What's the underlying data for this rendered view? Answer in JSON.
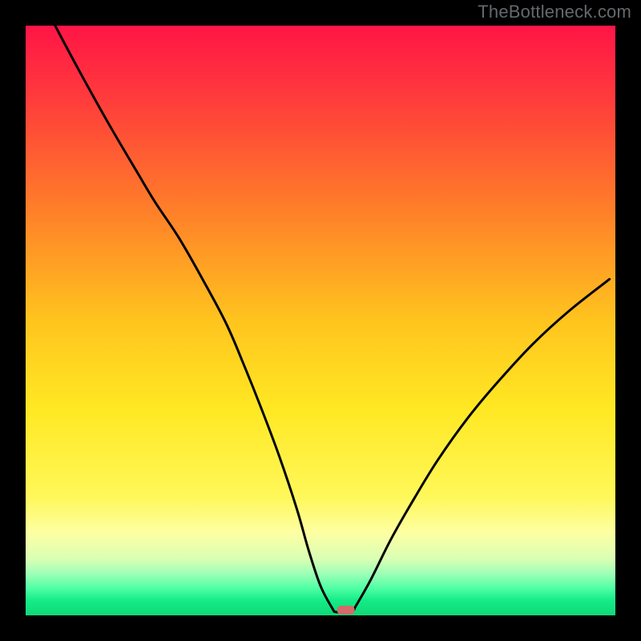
{
  "watermark": "TheBottleneck.com",
  "chart_data": {
    "type": "line",
    "title": "",
    "xlabel": "",
    "ylabel": "",
    "xlim": [
      0,
      100
    ],
    "ylim": [
      0,
      100
    ],
    "legend": [],
    "annotations": [],
    "gradient_stops": [
      {
        "offset": 0.0,
        "color": "#ff1546"
      },
      {
        "offset": 0.12,
        "color": "#ff3a3c"
      },
      {
        "offset": 0.3,
        "color": "#ff7a2a"
      },
      {
        "offset": 0.5,
        "color": "#ffc41e"
      },
      {
        "offset": 0.65,
        "color": "#ffe823"
      },
      {
        "offset": 0.8,
        "color": "#fff85a"
      },
      {
        "offset": 0.86,
        "color": "#feffa3"
      },
      {
        "offset": 0.905,
        "color": "#d8ffb4"
      },
      {
        "offset": 0.93,
        "color": "#9cffb6"
      },
      {
        "offset": 0.955,
        "color": "#4cffa3"
      },
      {
        "offset": 0.975,
        "color": "#14eb87"
      },
      {
        "offset": 1.0,
        "color": "#0fd977"
      }
    ],
    "series": [
      {
        "name": "bottleneck-curve",
        "x": [
          5.0,
          9.0,
          14.0,
          19.0,
          22.0,
          26.0,
          30.0,
          34.0,
          37.0,
          40.0,
          43.0,
          46.0,
          48.0,
          50.0,
          52.0,
          52.5,
          53.5,
          55.5,
          56.0,
          58.5,
          62.0,
          66.0,
          70.0,
          75.0,
          80.0,
          86.0,
          92.0,
          99.0
        ],
        "y": [
          100.0,
          92.5,
          83.5,
          75.0,
          70.0,
          64.0,
          57.0,
          49.5,
          42.5,
          35.0,
          27.0,
          18.0,
          11.0,
          5.0,
          1.2,
          0.6,
          0.6,
          0.9,
          1.6,
          6.0,
          13.0,
          20.0,
          26.5,
          33.5,
          39.5,
          46.0,
          51.5,
          57.0
        ]
      }
    ],
    "marker": {
      "x_pct": 54.3,
      "y_pct": 99.1,
      "color": "#d36b6b"
    }
  }
}
